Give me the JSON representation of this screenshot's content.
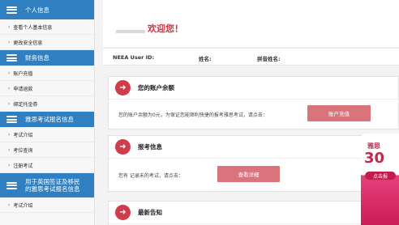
{
  "sidebar": {
    "sections": [
      {
        "title": "个人信息",
        "items": [
          "查看个人基本信息",
          "更改安全信息"
        ]
      },
      {
        "title": "财务信息",
        "items": [
          "账户充值",
          "申请退款",
          "绑定托金券"
        ]
      },
      {
        "title": "雅思考试报名信息",
        "items": [
          "考试介绍",
          "考位查询",
          "注册考试"
        ]
      },
      {
        "title": "用于英国签证及移民的雅思考试报名信息",
        "items": [
          "考试介绍"
        ]
      }
    ]
  },
  "main": {
    "welcome": "欢迎您！",
    "info": {
      "user_id_label": "NEEA User ID:",
      "name_label": "姓名:",
      "pinyin_label": "拼音姓名:"
    },
    "account": {
      "title": "您的账户余额",
      "message": "您的账户余额为0元，为保证您能顺利快捷的报考雅思考试，请点击：",
      "button": "账户充值"
    },
    "registration": {
      "title": "报考信息",
      "message": "您有   记录未的考试，请点击：",
      "button": "查看详细"
    },
    "news": {
      "title": "最新告知"
    }
  },
  "promo": {
    "line1": "雅思",
    "line2": "30",
    "line3": "点击报"
  }
}
